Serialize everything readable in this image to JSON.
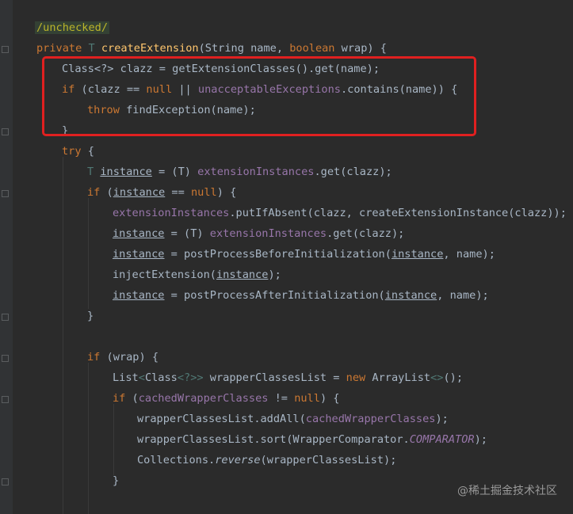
{
  "editor": {
    "watermark": "@稀土掘金技术社区",
    "colors": {
      "background": "#2b2b2b",
      "keyword": "#cc7832",
      "method": "#ffc66d",
      "field": "#9876aa",
      "text": "#a9b7c6",
      "highlight_box": "#e02020"
    }
  },
  "code": {
    "l1": {
      "annotation": "/unchecked/"
    },
    "l2": {
      "kw_private": "private",
      "type_t": "T",
      "method": "createExtension",
      "params_a": "(String name, ",
      "kw_boolean": "boolean",
      "params_b": " wrap) {"
    },
    "l3": {
      "text": "Class<?> clazz = getExtensionClasses().get(name);"
    },
    "l4": {
      "kw_if": "if",
      "a": " (clazz == ",
      "kw_null": "null",
      "b": " || ",
      "field": "unacceptableExceptions",
      "c": ".contains(name)) {"
    },
    "l5": {
      "kw_throw": "throw",
      "text": " findException(name);"
    },
    "l6": {
      "text": "}"
    },
    "l7": {
      "kw_try": "try",
      "text": " {"
    },
    "l8": {
      "type_t": "T",
      "var": "instance",
      "a": " = (T) ",
      "field": "extensionInstances",
      "b": ".get(clazz);"
    },
    "l9": {
      "kw_if": "if",
      "a": " (",
      "var": "instance",
      "b": " == ",
      "kw_null": "null",
      "c": ") {"
    },
    "l10": {
      "field": "extensionInstances",
      "text": ".putIfAbsent(clazz, createExtensionInstance(clazz));"
    },
    "l11": {
      "var": "instance",
      "a": " = (T) ",
      "field": "extensionInstances",
      "b": ".get(clazz);"
    },
    "l12": {
      "var": "instance",
      "a": " = postProcessBeforeInitialization(",
      "var2": "instance",
      "b": ", name);"
    },
    "l13": {
      "a": "injectExtension(",
      "var": "instance",
      "b": ");"
    },
    "l14": {
      "var": "instance",
      "a": " = postProcessAfterInitialization(",
      "var2": "instance",
      "b": ", name);"
    },
    "l15": {
      "text": "}"
    },
    "l16": {
      "kw_if": "if",
      "text": " (wrap) {"
    },
    "l17": {
      "a": "List",
      "g1": "<",
      "b": "Class",
      "g2": "<?>>",
      "c": " wrapperClassesList = ",
      "kw_new": "new",
      "d": " ArrayList",
      "g3": "<>",
      "e": "();"
    },
    "l18": {
      "kw_if": "if",
      "a": " (",
      "field": "cachedWrapperClasses",
      "b": " != ",
      "kw_null": "null",
      "c": ") {"
    },
    "l19": {
      "a": "wrapperClassesList.addAll(",
      "field": "cachedWrapperClasses",
      "b": ");"
    },
    "l20": {
      "a": "wrapperClassesList.sort(WrapperComparator.",
      "static_field": "COMPARATOR",
      "b": ");"
    },
    "l21": {
      "a": "Collections.",
      "static_method": "reverse",
      "b": "(wrapperClassesList);"
    },
    "l22": {
      "text": "}"
    }
  }
}
